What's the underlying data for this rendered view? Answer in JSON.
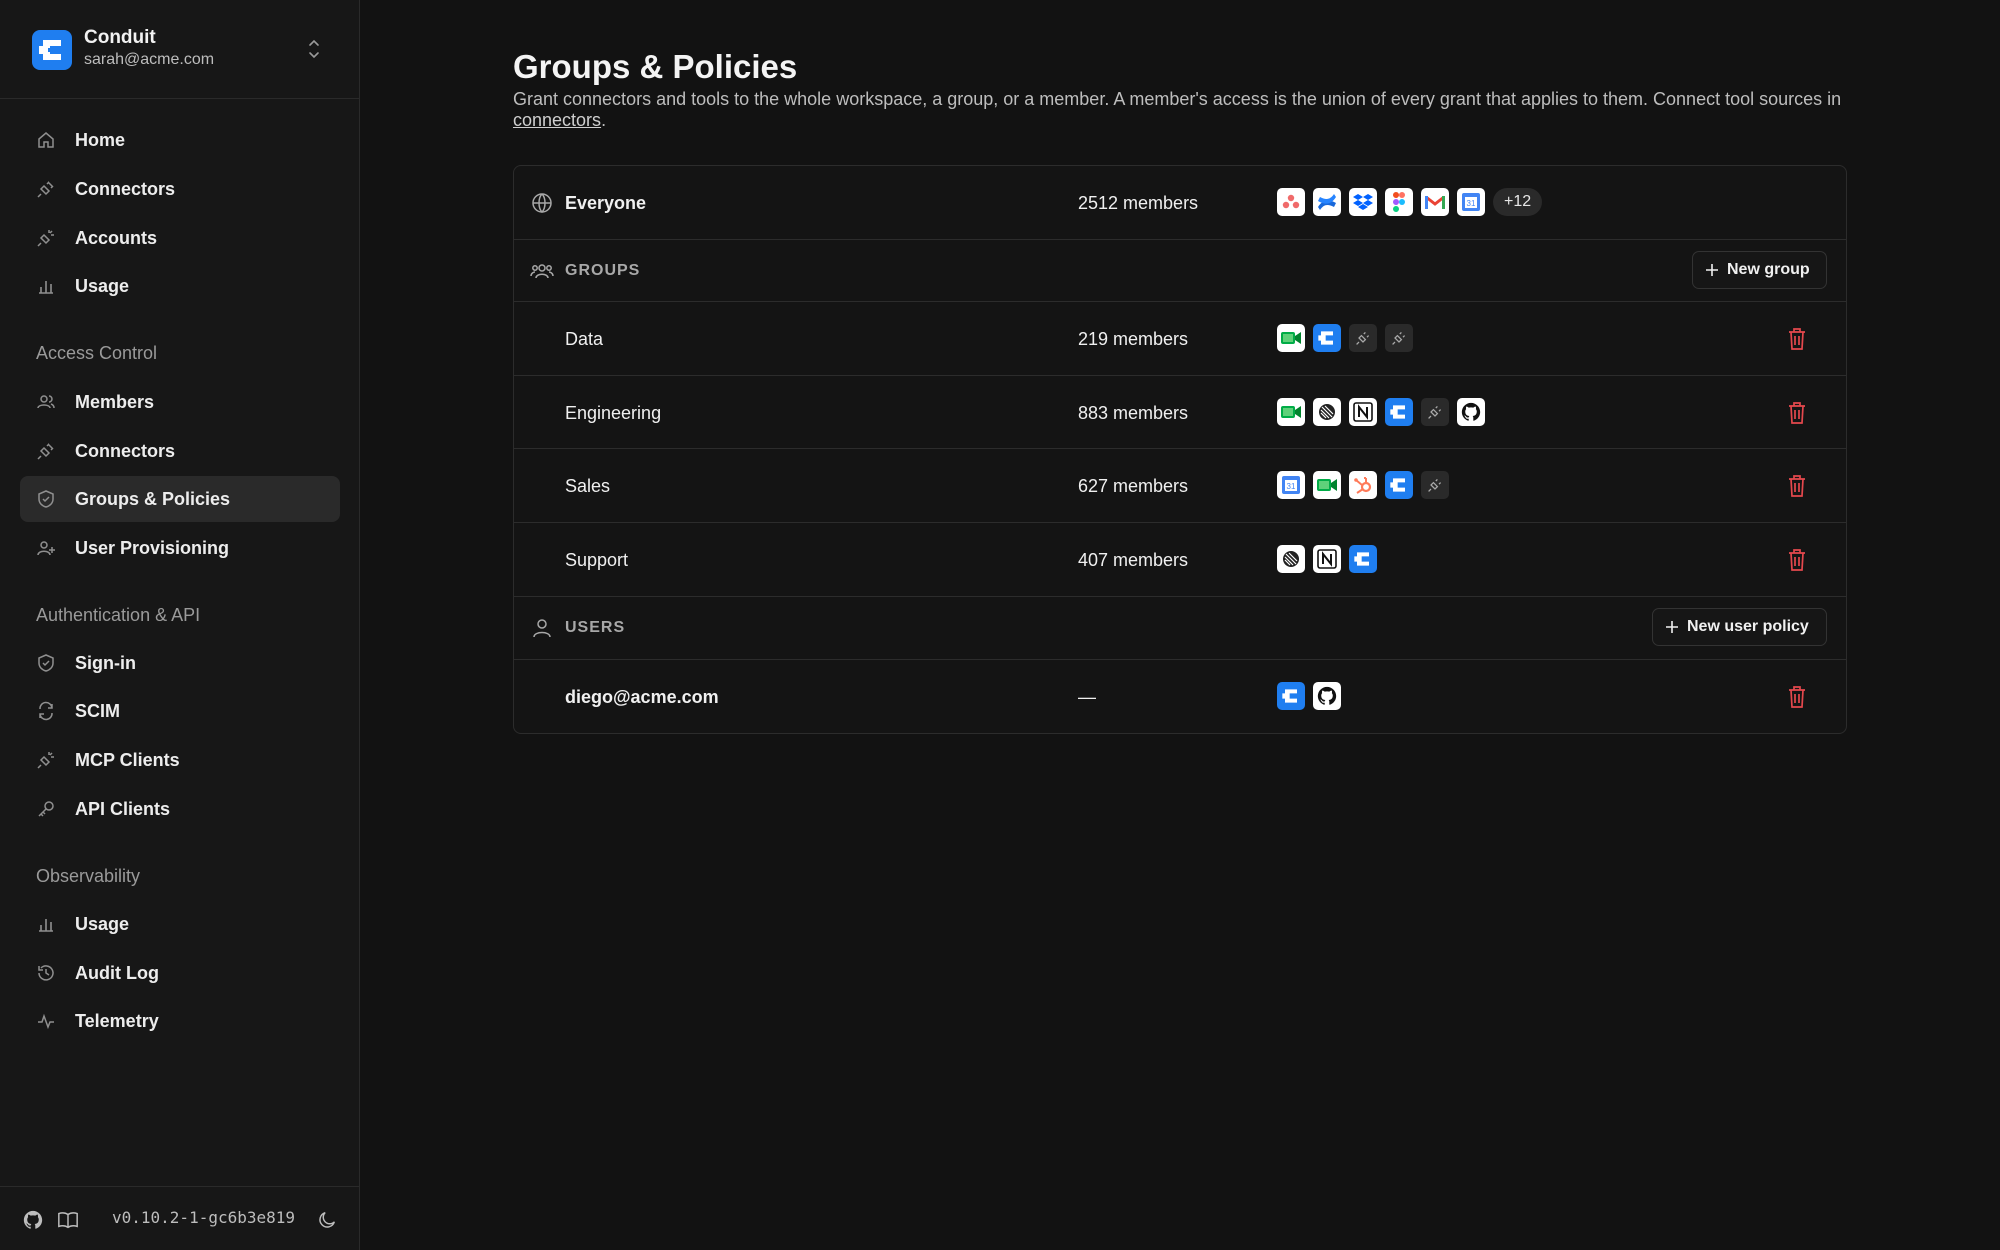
{
  "org": {
    "name": "Conduit",
    "email": "sarah@acme.com"
  },
  "nav": {
    "top": [
      {
        "label": "Home",
        "icon": "home-icon"
      },
      {
        "label": "Connectors",
        "icon": "plug-icon"
      },
      {
        "label": "Accounts",
        "icon": "plug-spark-icon"
      },
      {
        "label": "Usage",
        "icon": "bar-chart-icon"
      }
    ],
    "sections": [
      {
        "title": "Access Control",
        "items": [
          {
            "label": "Members",
            "icon": "users-icon"
          },
          {
            "label": "Connectors",
            "icon": "plug-icon"
          },
          {
            "label": "Groups & Policies",
            "icon": "shield-icon",
            "active": true
          },
          {
            "label": "User Provisioning",
            "icon": "user-plus-icon"
          }
        ]
      },
      {
        "title": "Authentication & API",
        "items": [
          {
            "label": "Sign-in",
            "icon": "shield-check-icon"
          },
          {
            "label": "SCIM",
            "icon": "sync-icon"
          },
          {
            "label": "MCP Clients",
            "icon": "plug-spark-icon"
          },
          {
            "label": "API Clients",
            "icon": "key-icon"
          }
        ]
      },
      {
        "title": "Observability",
        "items": [
          {
            "label": "Usage",
            "icon": "bar-chart-icon"
          },
          {
            "label": "Audit Log",
            "icon": "history-icon"
          },
          {
            "label": "Telemetry",
            "icon": "activity-icon"
          }
        ]
      }
    ]
  },
  "footer": {
    "version": "v0.10.2-1-gc6b3e819"
  },
  "page": {
    "title": "Groups & Policies",
    "description_prefix": "Grant connectors and tools to the whole workspace, a group, or a member. A member's access is the union of every grant that applies to them. Connect tool sources in ",
    "description_link": "connectors",
    "description_suffix": "."
  },
  "everyone": {
    "name": "Everyone",
    "members": "2512 members",
    "connectors": [
      "asana",
      "confluence",
      "dropbox",
      "figma",
      "gmail",
      "google-calendar"
    ],
    "more": "+12"
  },
  "groups_section": {
    "label": "GROUPS",
    "button": "New group"
  },
  "groups": [
    {
      "name": "Data",
      "members": "219 members",
      "connectors": [
        "google-meet",
        "conduit",
        "generic-plug",
        "generic-plug"
      ]
    },
    {
      "name": "Engineering",
      "members": "883 members",
      "connectors": [
        "google-meet",
        "linear",
        "notion",
        "conduit",
        "generic-plug",
        "github"
      ]
    },
    {
      "name": "Sales",
      "members": "627 members",
      "connectors": [
        "google-calendar",
        "google-meet",
        "hubspot",
        "conduit",
        "generic-plug"
      ]
    },
    {
      "name": "Support",
      "members": "407 members",
      "connectors": [
        "linear",
        "notion",
        "conduit"
      ]
    }
  ],
  "users_section": {
    "label": "USERS",
    "button": "New user policy"
  },
  "users": [
    {
      "name": "diego@acme.com",
      "members": "—",
      "connectors": [
        "conduit",
        "github"
      ]
    }
  ],
  "colors": {
    "accent": "#1f7ef0",
    "danger": "#e5484d",
    "background": "#121212",
    "sidebar": "#171717"
  }
}
